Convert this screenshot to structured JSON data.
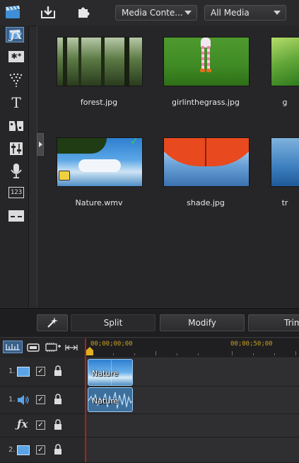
{
  "toolbar": {
    "content_dropdown": "Media Conte...",
    "filter_dropdown": "All Media"
  },
  "rail": {
    "icons": [
      "media-room-icon",
      "fx-icon",
      "pip-icon",
      "particle-icon",
      "title-icon",
      "transition-icon",
      "audio-mix-icon",
      "voice-record-icon",
      "chapter-icon",
      "subtitle-icon"
    ]
  },
  "media": {
    "items": [
      {
        "name": "forest.jpg"
      },
      {
        "name": "girlinthegrass.jpg"
      },
      {
        "name": "g"
      },
      {
        "name": "Nature.wmv"
      },
      {
        "name": "shade.jpg"
      },
      {
        "name": "tr"
      }
    ]
  },
  "actions": {
    "split": "Split",
    "modify": "Modify",
    "trim": "Trim"
  },
  "timeline": {
    "timecode_start": "00;00;00;00",
    "timecode_mark": "00;00;50;00",
    "tracks": [
      {
        "num": "1.",
        "clip": "Nature"
      },
      {
        "num": "1.",
        "clip": "Nature"
      },
      {
        "num": ""
      },
      {
        "num": "2."
      }
    ]
  }
}
